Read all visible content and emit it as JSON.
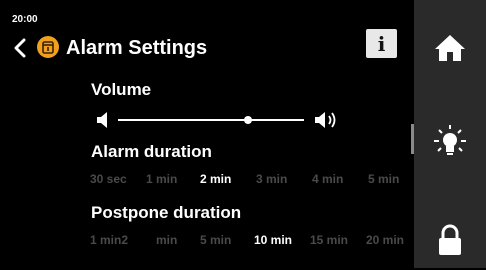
{
  "status": {
    "time": "20:00"
  },
  "header": {
    "title": "Alarm Settings",
    "info_label": "i"
  },
  "volume": {
    "label": "Volume",
    "level": 0.7
  },
  "alarm_duration": {
    "label": "Alarm duration",
    "options": [
      "30 sec",
      "1 min",
      "2 min",
      "3 min",
      "4 min",
      "5 min"
    ],
    "selected": "2 min"
  },
  "postpone_duration": {
    "label": "Postpone duration",
    "options": [
      "1 min2",
      "min",
      "5 min",
      "10 min",
      "15 min",
      "20 min"
    ],
    "selected": "10 min"
  },
  "sidebar": {
    "items": [
      {
        "icon": "home-icon"
      },
      {
        "icon": "light-bulb-icon"
      },
      {
        "icon": "lock-icon"
      }
    ]
  },
  "colors": {
    "background": "#000000",
    "sidebar": "#2a2a2a",
    "selected_text": "#ffffff",
    "unselected_text": "#4a4a4a",
    "app_icon": "#f0a020"
  }
}
